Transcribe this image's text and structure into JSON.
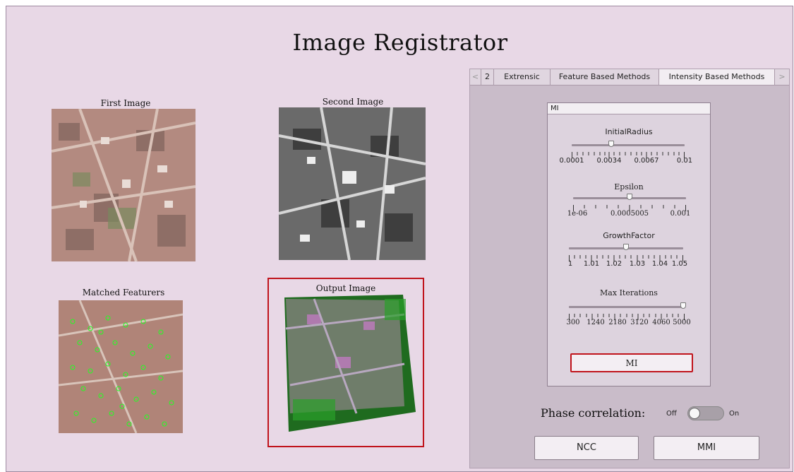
{
  "window": {
    "title": "Image Registrator"
  },
  "images": {
    "first_label": "First Image",
    "second_label": "Second Image",
    "matched_label": "Matched Featurers",
    "output_label": "Output Image"
  },
  "tabs": [
    {
      "label": "<"
    },
    {
      "label": "2"
    },
    {
      "label": "Extrensic"
    },
    {
      "label": "Feature Based Methods"
    },
    {
      "label": "Intensity Based Methods",
      "active": true
    },
    {
      "label": ">"
    }
  ],
  "mi_panel": {
    "title": "MI",
    "sliders": [
      {
        "label": "InitialRadius",
        "ticks": [
          "0.0001",
          "0.0034",
          "0.0067",
          "0.01"
        ],
        "value_fraction": 0.33
      },
      {
        "label": "Epsilon",
        "ticks": [
          "1e-06",
          "0.0005005",
          "0.001"
        ],
        "value_fraction": 0.5
      },
      {
        "label": "GrowthFactor",
        "ticks": [
          "1",
          "1.01",
          "1.02",
          "1.03",
          "1.04",
          "1.05"
        ],
        "value_fraction": 0.5
      },
      {
        "label": "Max Iterations",
        "ticks": [
          "300",
          "1240",
          "2180",
          "3120",
          "4060",
          "5000"
        ],
        "value_fraction": 1.0
      }
    ],
    "run_button": "MI"
  },
  "phase": {
    "label": "Phase correlation:",
    "off": "Off",
    "on": "On",
    "state": "Off"
  },
  "buttons": {
    "ncc": "NCC",
    "mmi": "MMI"
  },
  "colors": {
    "background": "#e8d8e6",
    "panel": "#c9bcc9",
    "highlight": "#c0141c",
    "feature_points": "#22ff22"
  }
}
